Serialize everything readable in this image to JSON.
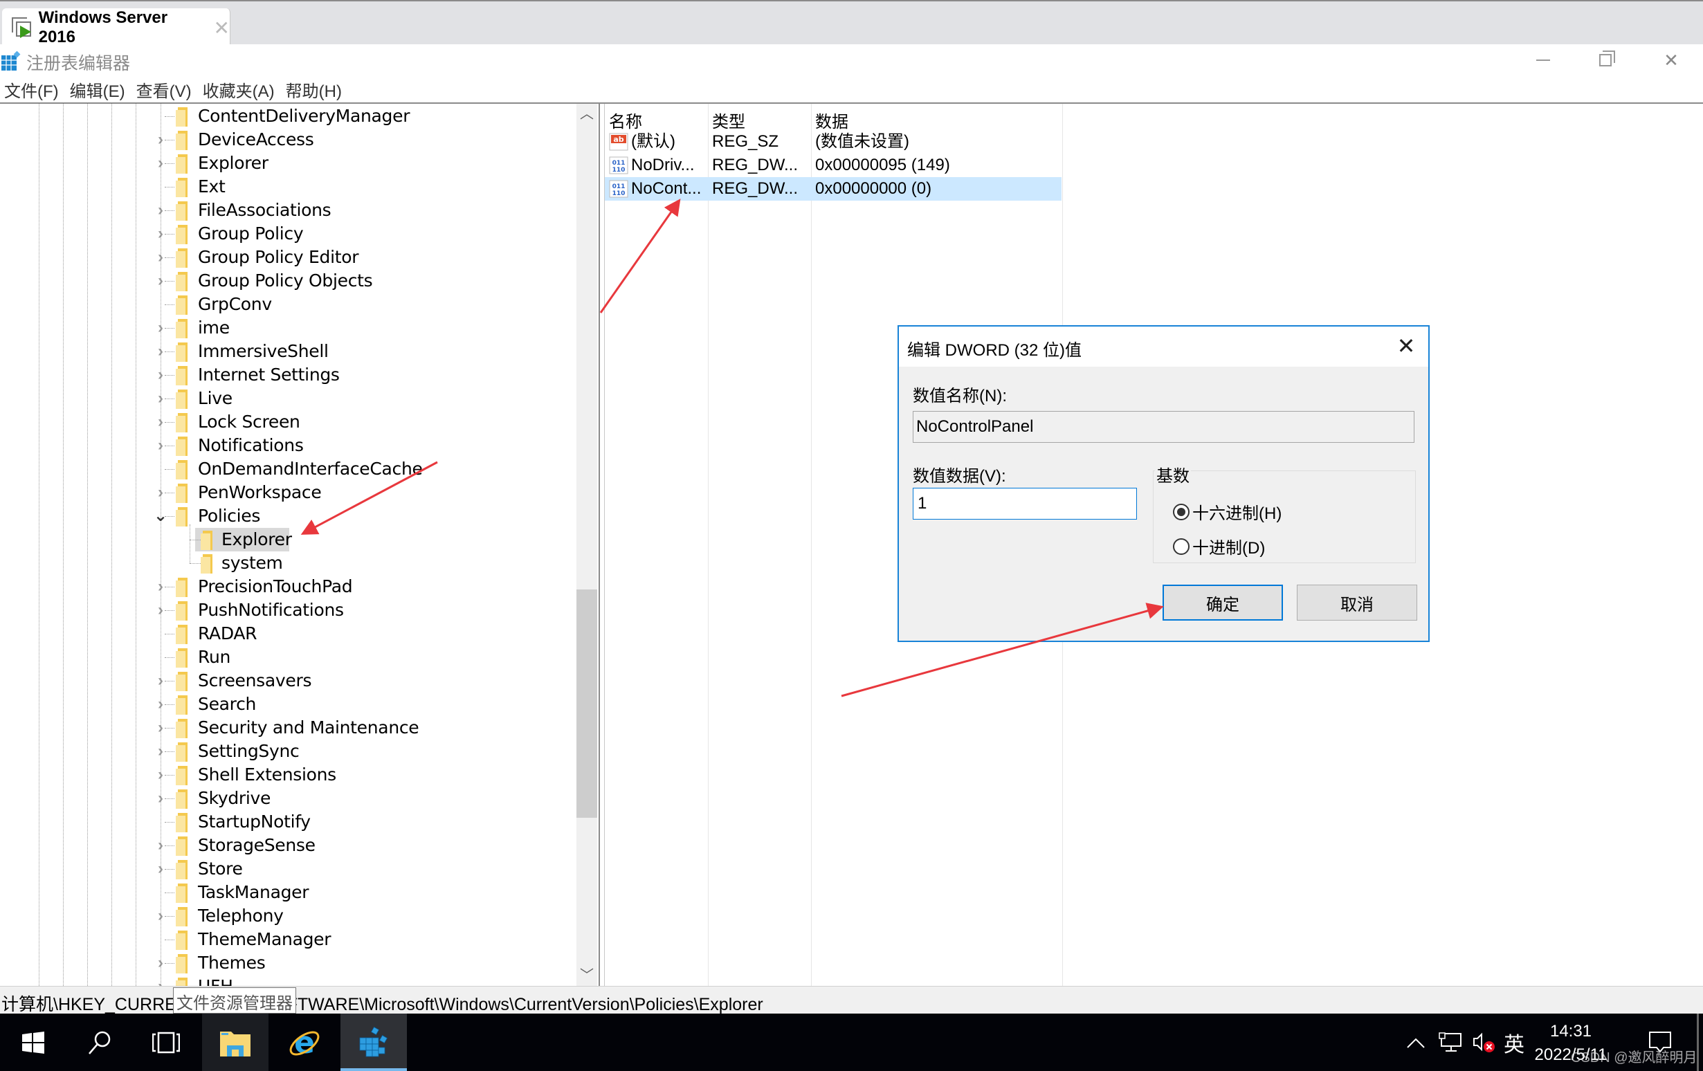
{
  "vm_tab": {
    "title": "Windows Server 2016",
    "close_glyph": "✕"
  },
  "app": {
    "title": "注册表编辑器"
  },
  "window_controls": {
    "minimize": "minimize",
    "maximize": "restore",
    "close": "✕"
  },
  "menu": [
    {
      "label": "文件(F)"
    },
    {
      "label": "编辑(E)"
    },
    {
      "label": "查看(V)"
    },
    {
      "label": "收藏夹(A)"
    },
    {
      "label": "帮助(H)"
    }
  ],
  "tree": {
    "items": [
      {
        "label": "ContentDeliveryManager",
        "expandable": false
      },
      {
        "label": "DeviceAccess",
        "expandable": true
      },
      {
        "label": "Explorer",
        "expandable": true
      },
      {
        "label": "Ext",
        "expandable": false
      },
      {
        "label": "FileAssociations",
        "expandable": true
      },
      {
        "label": "Group Policy",
        "expandable": true
      },
      {
        "label": "Group Policy Editor",
        "expandable": true
      },
      {
        "label": "Group Policy Objects",
        "expandable": true
      },
      {
        "label": "GrpConv",
        "expandable": false
      },
      {
        "label": "ime",
        "expandable": true
      },
      {
        "label": "ImmersiveShell",
        "expandable": true
      },
      {
        "label": "Internet Settings",
        "expandable": true
      },
      {
        "label": "Live",
        "expandable": true
      },
      {
        "label": "Lock Screen",
        "expandable": true
      },
      {
        "label": "Notifications",
        "expandable": true
      },
      {
        "label": "OnDemandInterfaceCache",
        "expandable": false
      },
      {
        "label": "PenWorkspace",
        "expandable": true
      },
      {
        "label": "Policies",
        "expandable": true,
        "expanded": true
      },
      {
        "label": "Explorer",
        "child": true,
        "selected": true
      },
      {
        "label": "system",
        "child": true
      },
      {
        "label": "PrecisionTouchPad",
        "expandable": true
      },
      {
        "label": "PushNotifications",
        "expandable": true
      },
      {
        "label": "RADAR",
        "expandable": false
      },
      {
        "label": "Run",
        "expandable": false
      },
      {
        "label": "Screensavers",
        "expandable": true
      },
      {
        "label": "Search",
        "expandable": true
      },
      {
        "label": "Security and Maintenance",
        "expandable": true
      },
      {
        "label": "SettingSync",
        "expandable": true
      },
      {
        "label": "Shell Extensions",
        "expandable": true
      },
      {
        "label": "Skydrive",
        "expandable": true
      },
      {
        "label": "StartupNotify",
        "expandable": false
      },
      {
        "label": "StorageSense",
        "expandable": true
      },
      {
        "label": "Store",
        "expandable": true
      },
      {
        "label": "TaskManager",
        "expandable": false
      },
      {
        "label": "Telephony",
        "expandable": true
      },
      {
        "label": "ThemeManager",
        "expandable": false
      },
      {
        "label": "Themes",
        "expandable": true
      },
      {
        "label": "UFH",
        "expandable": true
      }
    ]
  },
  "list": {
    "headers": {
      "name": "名称",
      "type": "类型",
      "data": "数据"
    },
    "rows": [
      {
        "icon": "string-value-icon",
        "name": "(默认)",
        "type": "REG_SZ",
        "data": "(数值未设置)",
        "selected": false
      },
      {
        "icon": "dword-value-icon",
        "name": "NoDriv...",
        "type": "REG_DW...",
        "data": "0x00000095 (149)",
        "selected": false
      },
      {
        "icon": "dword-value-icon",
        "name": "NoCont...",
        "type": "REG_DW...",
        "data": "0x00000000 (0)",
        "selected": true
      }
    ]
  },
  "statusbar": {
    "path": "计算机\\HKEY_CURRENT_USER\\SOFTWARE\\Microsoft\\Windows\\CurrentVersion\\Policies\\Explorer",
    "tooltip": "文件资源管理器"
  },
  "dialog": {
    "title": "编辑 DWORD (32 位)值",
    "close_glyph": "✕",
    "name_label": "数值名称(N):",
    "name_value": "NoControlPanel",
    "data_label": "数值数据(V):",
    "data_value": "1",
    "base_label": "基数",
    "radio_hex": "十六进制(H)",
    "radio_dec": "十进制(D)",
    "base_selected": "hex",
    "ok": "确定",
    "cancel": "取消"
  },
  "taskbar": {
    "apps": [
      "start",
      "search",
      "task-view",
      "file-explorer",
      "internet-explorer",
      "registry-editor"
    ],
    "active_app": "registry-editor",
    "ime": "英",
    "time": "14:31",
    "date": "2022/5/11"
  },
  "watermark": "CSDN @邀风醉明月",
  "colors": {
    "accent": "#0078d7",
    "selection": "#cce8ff",
    "tree_selection": "#d9d9d9",
    "annotation_arrow": "#e8383d",
    "taskbar": "#020308"
  }
}
